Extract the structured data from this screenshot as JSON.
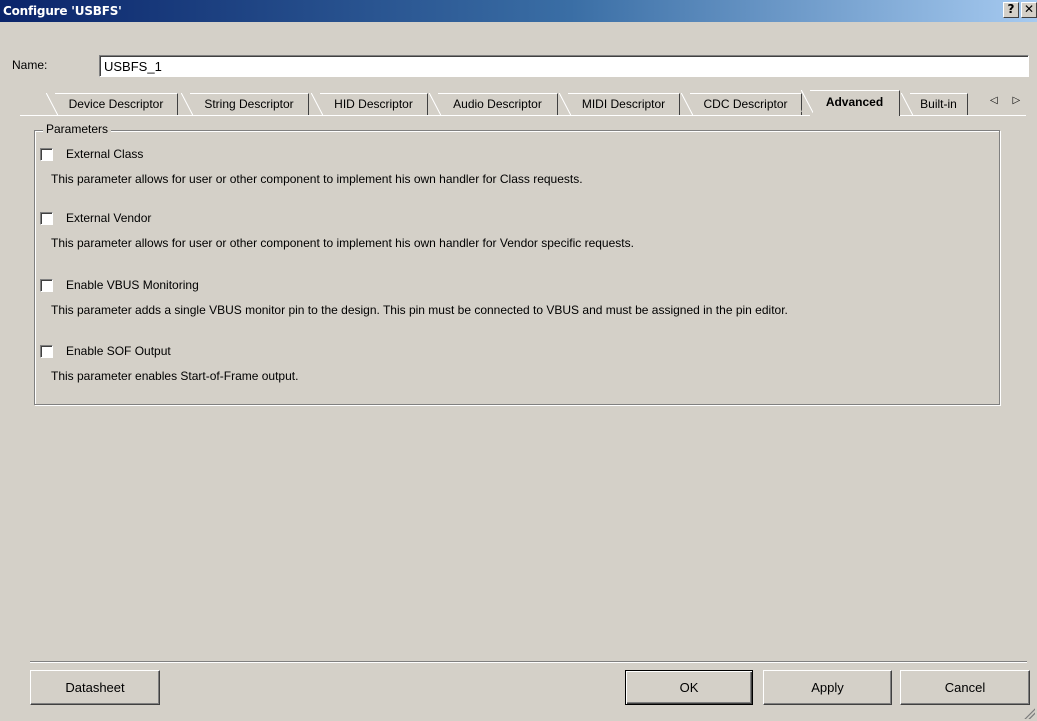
{
  "window": {
    "title": "Configure 'USBFS'",
    "help_label": "?",
    "close_label": "✕"
  },
  "name_field": {
    "label": "Name:",
    "value": "USBFS_1"
  },
  "tabs": [
    {
      "label": "Device Descriptor"
    },
    {
      "label": "String Descriptor"
    },
    {
      "label": "HID Descriptor"
    },
    {
      "label": "Audio Descriptor"
    },
    {
      "label": "MIDI Descriptor"
    },
    {
      "label": "CDC Descriptor"
    },
    {
      "label": "Advanced",
      "active": true
    },
    {
      "label": "Built-in"
    }
  ],
  "tab_scroll": "◁ ▷",
  "parameters": {
    "legend": "Parameters",
    "items": [
      {
        "label": "External Class",
        "checked": false,
        "description": "This parameter allows for user or other component to implement his own handler for Class requests."
      },
      {
        "label": "External Vendor",
        "checked": false,
        "description": "This parameter allows for user or other component to implement his own handler for Vendor specific requests."
      },
      {
        "label": "Enable VBUS Monitoring",
        "checked": false,
        "description": "This parameter adds a single VBUS monitor pin to the design. This pin must be connected to VBUS and must be assigned in the pin editor."
      },
      {
        "label": "Enable SOF Output",
        "checked": false,
        "description": "This parameter enables Start-of-Frame output."
      }
    ]
  },
  "buttons": {
    "datasheet": "Datasheet",
    "ok": "OK",
    "apply": "Apply",
    "cancel": "Cancel"
  }
}
